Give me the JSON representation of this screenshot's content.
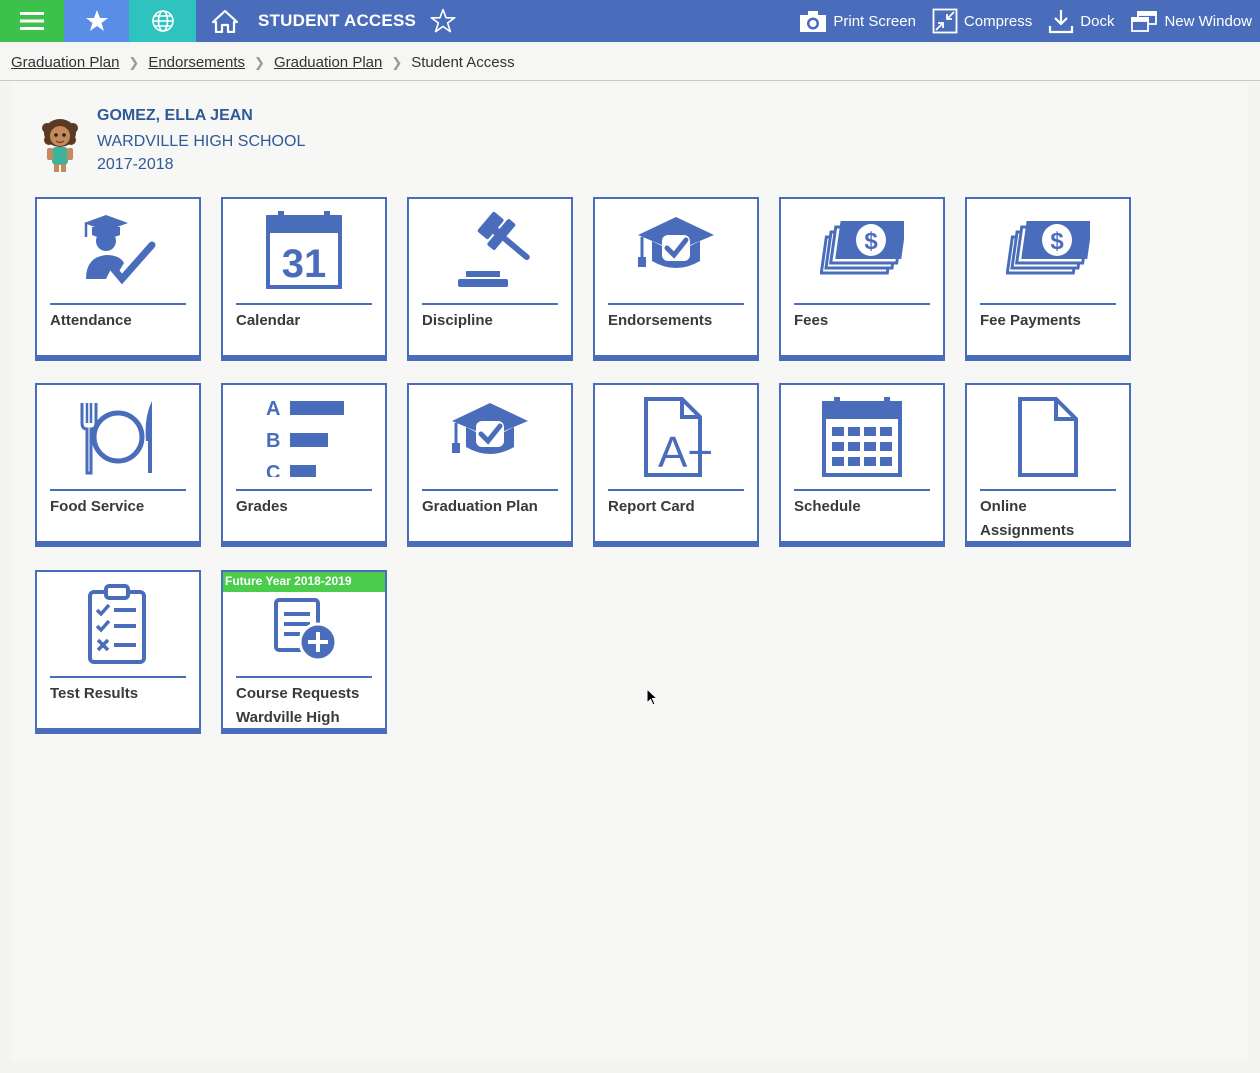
{
  "topbar": {
    "title": "STUDENT ACCESS",
    "actions": [
      {
        "label": "Print Screen",
        "icon": "camera-icon"
      },
      {
        "label": "Compress",
        "icon": "compress-icon"
      },
      {
        "label": "Dock",
        "icon": "dock-icon"
      },
      {
        "label": "New Window",
        "icon": "new-window-icon"
      }
    ]
  },
  "breadcrumb": [
    "Graduation Plan",
    "Endorsements",
    "Graduation Plan",
    "Student Access"
  ],
  "student": {
    "name": "GOMEZ, ELLA JEAN",
    "school": "WARDVILLE HIGH SCHOOL",
    "year": "2017-2018"
  },
  "tiles": [
    {
      "label": "Attendance",
      "icon": "attendance-icon"
    },
    {
      "label": "Calendar",
      "icon": "calendar-icon",
      "day": "31"
    },
    {
      "label": "Discipline",
      "icon": "gavel-icon"
    },
    {
      "label": "Endorsements",
      "icon": "graduation-cap-check-icon"
    },
    {
      "label": "Fees",
      "icon": "money-icon"
    },
    {
      "label": "Fee Payments",
      "icon": "money-icon"
    },
    {
      "label": "Food Service",
      "icon": "plate-fork-knife-icon"
    },
    {
      "label": "Grades",
      "icon": "grades-icon",
      "letters": [
        "A",
        "B",
        "C"
      ]
    },
    {
      "label": "Graduation Plan",
      "icon": "graduation-cap-check-icon"
    },
    {
      "label": "Report Card",
      "icon": "report-card-icon",
      "grade": "A+"
    },
    {
      "label": "Schedule",
      "icon": "schedule-icon"
    },
    {
      "label": "Online Assignments",
      "icon": "document-icon"
    },
    {
      "label": "Test Results",
      "icon": "clipboard-icon"
    },
    {
      "label": "Course Requests Wardville High",
      "icon": "add-document-icon",
      "badge": "Future Year 2018-2019"
    }
  ],
  "colors": {
    "primary": "#4a6dbb",
    "menu": "#3cc24b",
    "favorites": "#5a8ee6",
    "globe": "#2ec3bf",
    "badge": "#4ccc4c",
    "student_text": "#2f5a97"
  }
}
